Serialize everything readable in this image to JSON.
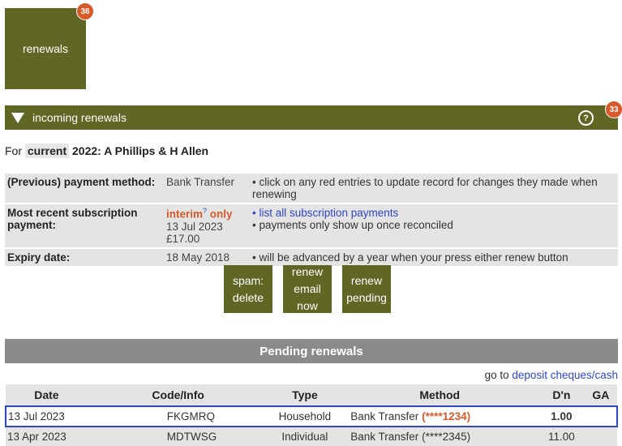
{
  "tile": {
    "label": "renewals",
    "badge": "36"
  },
  "incoming": {
    "label": "incoming renewals",
    "help": "?",
    "badge": "33"
  },
  "for_line": {
    "prefix": "For",
    "tag": "current",
    "title": "2022: A Phillips & H Allen"
  },
  "info": {
    "row1": {
      "heading": "(Previous) payment method:",
      "value": "Bank Transfer",
      "note": "• click on any red entries to update record for changes they made when renewing"
    },
    "row2": {
      "heading": "Most recent subscription payment:",
      "value_interim": "interim",
      "value_help": "?",
      "value_only": "only",
      "value_date": "13 Jul 2023 £17.00",
      "link": "• list all subscription payments",
      "note": "• payments only show up once reconciled"
    },
    "row3": {
      "heading": "Expiry date:",
      "value": "18 May 2018",
      "note": "• will be advanced by a year when your press either renew button"
    }
  },
  "buttons": {
    "spam_l1": "spam:",
    "spam_l2": "delete",
    "renew_email_l1": "renew",
    "renew_email_l2": "email now",
    "renew_pending_l1": "renew",
    "renew_pending_l2": "pending"
  },
  "pending": {
    "title": "Pending renewals",
    "goto_prefix": "go to",
    "goto_link": "deposit cheques/cash",
    "columns": [
      "Date",
      "Code/Info",
      "Type",
      "Method",
      "D'n",
      "GA"
    ],
    "rows": [
      {
        "date": "13 Jul 2023",
        "code": "FKGMRQ",
        "type": "Household",
        "method": "Bank Transfer",
        "method_ref": "(****1234)",
        "dn": "1.00",
        "ga": ""
      },
      {
        "date": "13 Apr 2023",
        "code": "MDTWSG",
        "type": "Individual",
        "method": "Bank Transfer",
        "method_ref": "(****2345)",
        "dn": "11.00",
        "ga": ""
      }
    ]
  },
  "colors": {
    "olive": "#606624",
    "badge": "#d8592a",
    "link": "#2f45c8"
  }
}
